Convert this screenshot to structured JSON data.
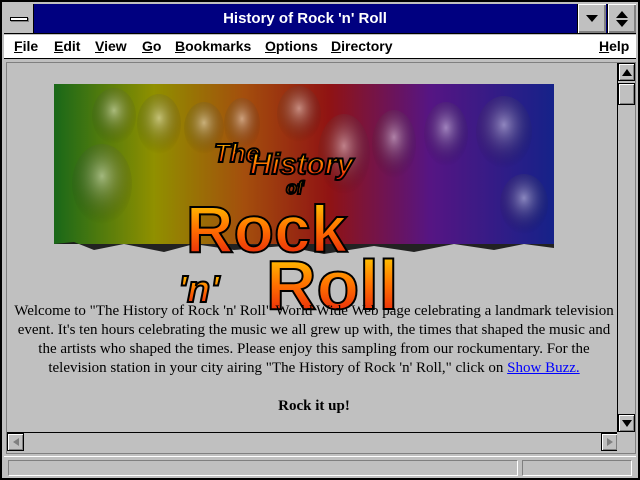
{
  "window": {
    "title": "History of Rock 'n' Roll"
  },
  "menubar": {
    "items": [
      "File",
      "Edit",
      "View",
      "Go",
      "Bookmarks",
      "Options",
      "Directory",
      "Help"
    ]
  },
  "banner": {
    "line1": "The",
    "line2": "History",
    "line3": "of",
    "line4": "Rock",
    "line5": "'n'",
    "line6": "Roll",
    "colors": [
      "#2aa02a",
      "#d4d000",
      "#e08020",
      "#d42020",
      "#8020c0",
      "#2040d0"
    ]
  },
  "page": {
    "welcome_text": "Welcome to \"The History of Rock 'n' Roll\" World Wide Web page celebrating a landmark television event. It's ten hours celebrating the music we all grew up with, the times that shaped the music and the artists who shaped the times. Please enjoy this sampling from our rockumentary. For the television station in your city airing \"The History of Rock 'n' Roll,\" click on",
    "link_text": "Show Buzz.",
    "tagline": "Rock it up!"
  }
}
